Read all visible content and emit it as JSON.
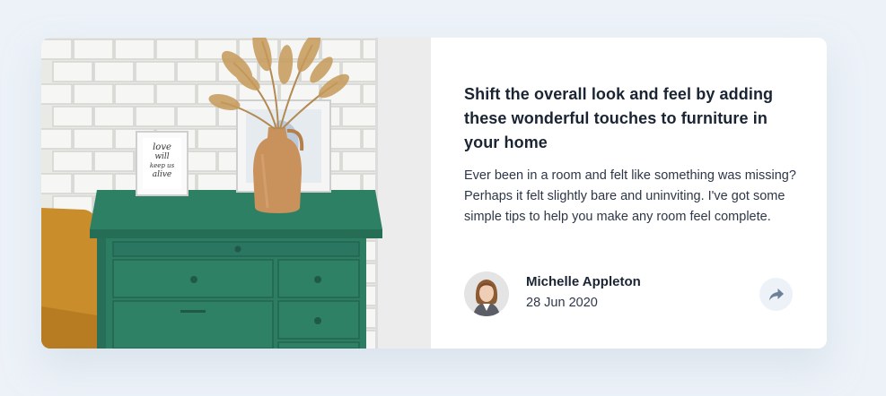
{
  "article": {
    "headline": "Shift the overall look and feel by adding these wonderful touches to furniture in your home",
    "excerpt": "Ever been in a room and felt like something was missing? Perhaps it felt slightly bare and uninviting. I've got some simple tips to help you make any room feel complete.",
    "image": {
      "frame_text_lines": [
        "love",
        "will",
        "keep us",
        "alive"
      ]
    }
  },
  "author": {
    "name": "Michelle Appleton",
    "date": "28 Jun 2020",
    "avatar_icon": "avatar-photo"
  },
  "share": {
    "icon": "share-icon"
  },
  "colors": {
    "background": "#ecf2f8",
    "card": "#ffffff",
    "headline": "#1b2433",
    "body_text": "#2e3748",
    "share_button_bg": "#ecf2f8",
    "share_icon": "#6e8098",
    "dresser": "#2d7d63"
  }
}
